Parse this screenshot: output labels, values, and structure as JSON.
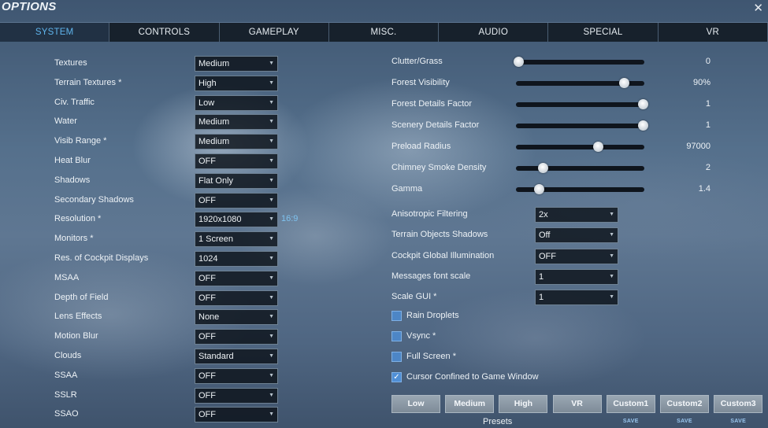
{
  "window": {
    "title": "OPTIONS",
    "close_glyph": "✕"
  },
  "tabs": [
    {
      "label": "SYSTEM",
      "active": true
    },
    {
      "label": "CONTROLS"
    },
    {
      "label": "GAMEPLAY"
    },
    {
      "label": "MISC."
    },
    {
      "label": "AUDIO"
    },
    {
      "label": "SPECIAL"
    },
    {
      "label": "VR"
    }
  ],
  "left_settings": [
    {
      "label": "Textures",
      "value": "Medium"
    },
    {
      "label": "Terrain Textures *",
      "value": "High"
    },
    {
      "label": "Civ. Traffic",
      "value": "Low"
    },
    {
      "label": "Water",
      "value": "Medium"
    },
    {
      "label": "Visib Range *",
      "value": "Medium"
    },
    {
      "label": "Heat Blur",
      "value": "OFF"
    },
    {
      "label": "Shadows",
      "value": "Flat Only"
    },
    {
      "label": "Secondary Shadows",
      "value": "OFF"
    },
    {
      "label": "Resolution *",
      "value": "1920x1080",
      "note": "16:9"
    },
    {
      "label": "Monitors *",
      "value": "1 Screen"
    },
    {
      "label": "Res. of Cockpit Displays",
      "value": "1024"
    },
    {
      "label": "MSAA",
      "value": "OFF"
    },
    {
      "label": "Depth of Field",
      "value": "OFF"
    },
    {
      "label": "Lens Effects",
      "value": "None"
    },
    {
      "label": "Motion Blur",
      "value": "OFF"
    },
    {
      "label": "Clouds",
      "value": "Standard"
    },
    {
      "label": "SSAA",
      "value": "OFF"
    },
    {
      "label": "SSLR",
      "value": "OFF"
    },
    {
      "label": "SSAO",
      "value": "OFF"
    }
  ],
  "sliders": [
    {
      "label": "Clutter/Grass",
      "display": "0",
      "fraction": 0.02
    },
    {
      "label": "Forest Visibility",
      "display": "90%",
      "fraction": 0.84
    },
    {
      "label": "Forest Details Factor",
      "display": "1",
      "fraction": 0.99
    },
    {
      "label": "Scenery Details Factor",
      "display": "1",
      "fraction": 0.99
    },
    {
      "label": "Preload Radius",
      "display": "97000",
      "fraction": 0.64
    },
    {
      "label": "Chimney Smoke Density",
      "display": "2",
      "fraction": 0.21
    },
    {
      "label": "Gamma",
      "display": "1.4",
      "fraction": 0.18
    }
  ],
  "right_dropdowns": [
    {
      "label": "Anisotropic Filtering",
      "value": "2x"
    },
    {
      "label": "Terrain Objects Shadows",
      "value": "Off"
    },
    {
      "label": "Cockpit Global Illumination",
      "value": "OFF"
    },
    {
      "label": "Messages font scale",
      "value": "1"
    },
    {
      "label": "Scale GUI *",
      "value": "1"
    }
  ],
  "checkboxes": [
    {
      "label": "Rain Droplets",
      "checked": false
    },
    {
      "label": "Vsync *",
      "checked": false
    },
    {
      "label": "Full Screen *",
      "checked": false
    },
    {
      "label": "Cursor Confined to Game Window",
      "checked": true
    }
  ],
  "presets": {
    "label": "Presets",
    "save_label": "SAVE",
    "buttons": [
      {
        "label": "Low"
      },
      {
        "label": "Medium"
      },
      {
        "label": "High"
      },
      {
        "label": "VR"
      },
      {
        "label": "Custom1",
        "savable": true
      },
      {
        "label": "Custom2",
        "savable": true
      },
      {
        "label": "Custom3",
        "savable": true
      }
    ]
  },
  "colors": {
    "accent": "#5fb4ec",
    "checkbox": "#4f8fd6",
    "tab_bar": "#141c26"
  }
}
